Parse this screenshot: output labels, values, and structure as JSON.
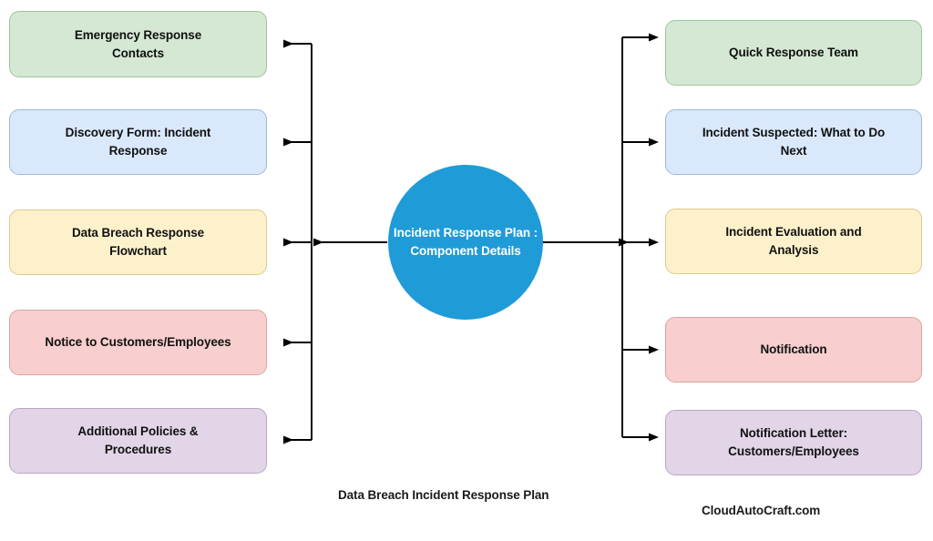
{
  "diagram": {
    "title_caption": "Data Breach Incident Response Plan",
    "watermark": "CloudAutoCraft.com",
    "hub": {
      "line1": "Incident Response Plan",
      "line2": ": Component Details",
      "color": "#1f9bd8",
      "text_color": "#ffffff"
    },
    "left_nodes": [
      {
        "line1": "Emergency Response",
        "line2": "Contacts",
        "fill": "#d5e8d4",
        "stroke": "#9ec79b"
      },
      {
        "line1": "Discovery Form: Incident",
        "line2": "Response",
        "fill": "#dae8fc",
        "stroke": "#9fb8db"
      },
      {
        "line1": "Data Breach Response",
        "line2": "Flowchart",
        "fill": "#fdf1cc",
        "stroke": "#dcc98c"
      },
      {
        "line1": "Notice to Customers/Employees",
        "line2": "",
        "fill": "#f8cece",
        "stroke": "#dfa3a3"
      },
      {
        "line1": "Additional Policies &",
        "line2": "Procedures",
        "fill": "#e1d5e7",
        "stroke": "#b9a7c4"
      }
    ],
    "right_nodes": [
      {
        "line1": "Quick Response Team",
        "line2": "",
        "fill": "#d5e8d4",
        "stroke": "#9ec79b"
      },
      {
        "line1": "Incident Suspected: What to Do",
        "line2": "Next",
        "fill": "#dae8fc",
        "stroke": "#9fb8db"
      },
      {
        "line1": "Incident Evaluation and",
        "line2": "Analysis",
        "fill": "#fdf1cc",
        "stroke": "#dcc98c"
      },
      {
        "line1": "Notification",
        "line2": "",
        "fill": "#f8cece",
        "stroke": "#dfa3a3"
      },
      {
        "line1": "Notification Letter:",
        "line2": "Customers/Employees",
        "fill": "#e1d5e7",
        "stroke": "#b9a7c4"
      }
    ],
    "connector_color": "#000000"
  }
}
